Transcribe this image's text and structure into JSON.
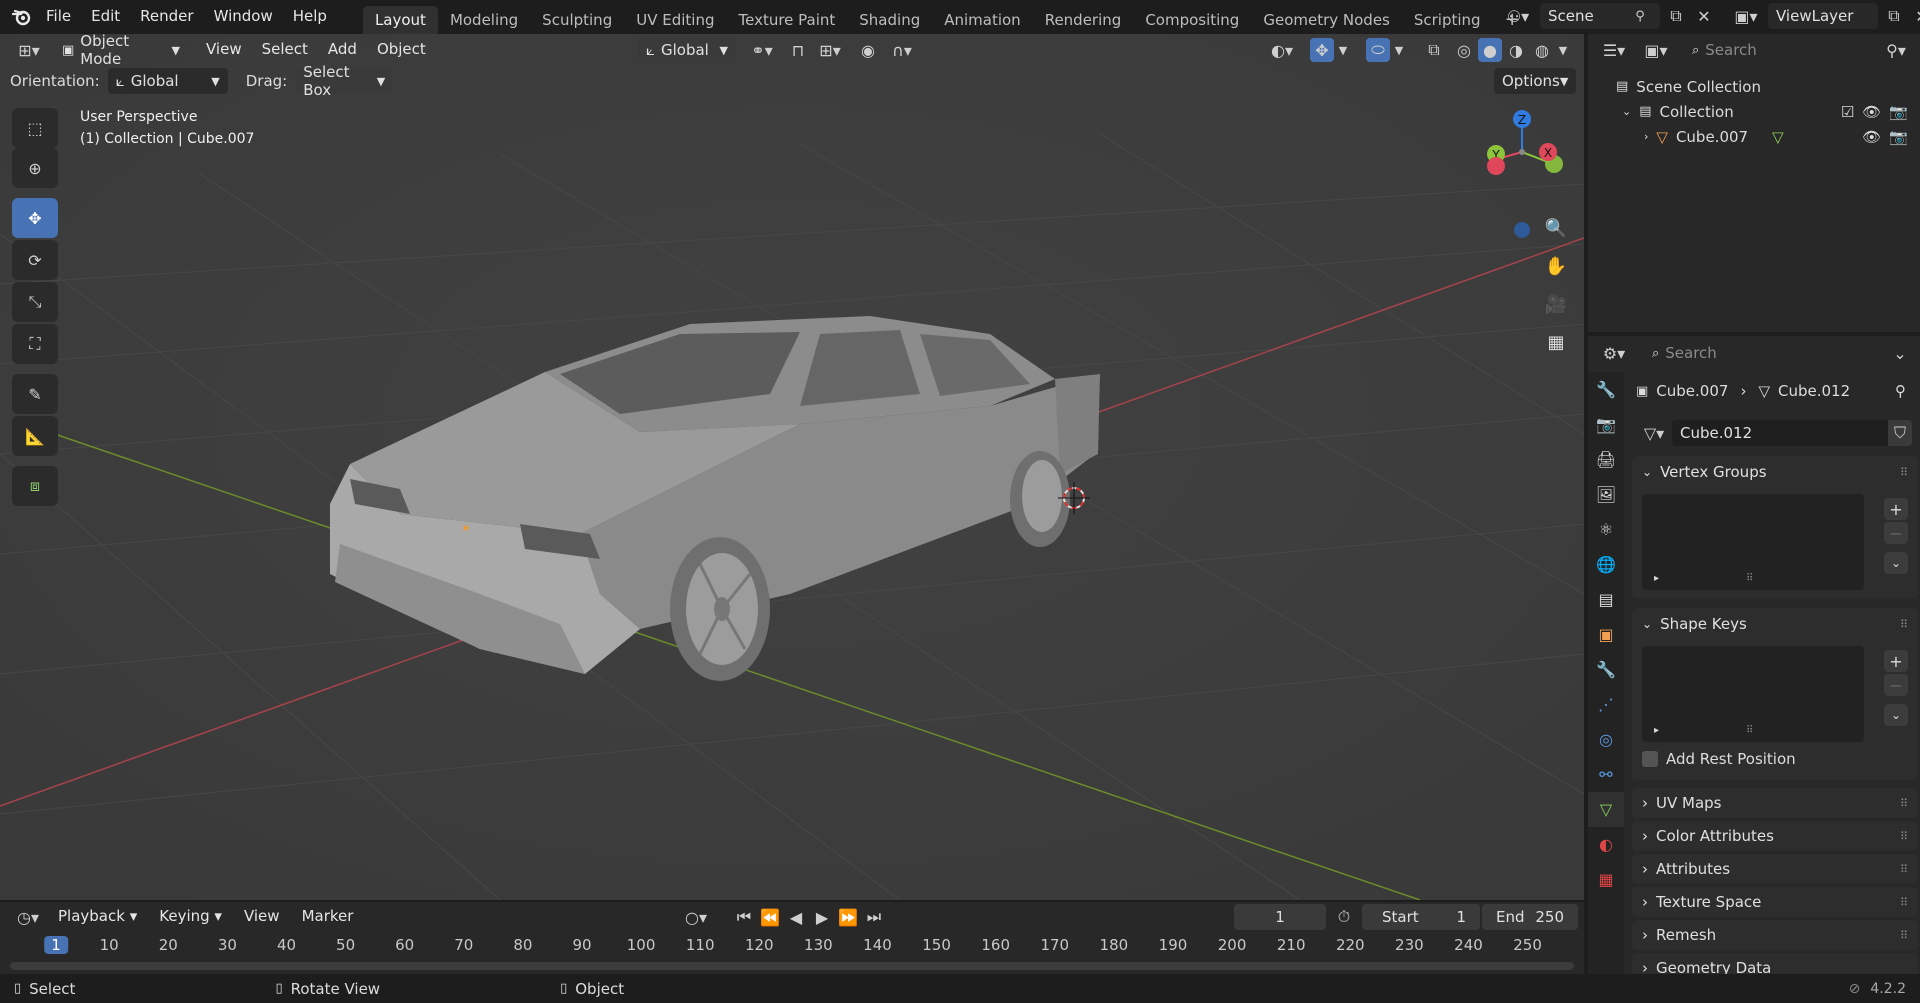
{
  "topbar": {
    "menus": [
      "File",
      "Edit",
      "Render",
      "Window",
      "Help"
    ],
    "workspaces": [
      "Layout",
      "Modeling",
      "Sculpting",
      "UV Editing",
      "Texture Paint",
      "Shading",
      "Animation",
      "Rendering",
      "Compositing",
      "Geometry Nodes",
      "Scripting"
    ],
    "active_workspace": "Layout",
    "add_tab": "+",
    "scene": "Scene",
    "view_layer": "ViewLayer"
  },
  "viewport": {
    "mode": "Object Mode",
    "menus": [
      "View",
      "Select",
      "Add",
      "Object"
    ],
    "transform_orientation": "Global",
    "orientation_label": "Orientation:",
    "orientation_value": "Global",
    "drag_label": "Drag:",
    "drag_value": "Select Box",
    "options": "Options",
    "overlay_title": "User Perspective",
    "overlay_subtitle": "(1) Collection | Cube.007",
    "gizmo_axes": {
      "z": "Z",
      "y": "Y",
      "x": "X"
    },
    "colors": {
      "x_axis": "#e0475a",
      "y_axis": "#8cc43c",
      "z_axis": "#2f7be0",
      "active_tool": "#4772b3"
    }
  },
  "outliner": {
    "search_placeholder": "Search",
    "scene_collection": "Scene Collection",
    "collection": "Collection",
    "object": "Cube.007"
  },
  "properties": {
    "search_placeholder": "Search",
    "breadcrumb_object": "Cube.007",
    "breadcrumb_data": "Cube.012",
    "mesh_name": "Cube.012",
    "panels": {
      "vertex_groups": "Vertex Groups",
      "shape_keys": "Shape Keys",
      "add_rest_position": "Add Rest Position",
      "uv_maps": "UV Maps",
      "color_attributes": "Color Attributes",
      "attributes": "Attributes",
      "texture_space": "Texture Space",
      "remesh": "Remesh",
      "geometry_data": "Geometry Data"
    }
  },
  "timeline": {
    "menus": [
      "Playback",
      "Keying",
      "View",
      "Marker"
    ],
    "current_frame": "1",
    "start_label": "Start",
    "start": "1",
    "end_label": "End",
    "end": "250",
    "ruler": [
      "1",
      "10",
      "20",
      "30",
      "40",
      "50",
      "60",
      "70",
      "80",
      "90",
      "100",
      "110",
      "120",
      "130",
      "140",
      "150",
      "160",
      "170",
      "180",
      "190",
      "200",
      "210",
      "220",
      "230",
      "240",
      "250"
    ]
  },
  "statusbar": {
    "select": "Select",
    "rotate": "Rotate View",
    "object": "Object",
    "version": "4.2.2"
  }
}
